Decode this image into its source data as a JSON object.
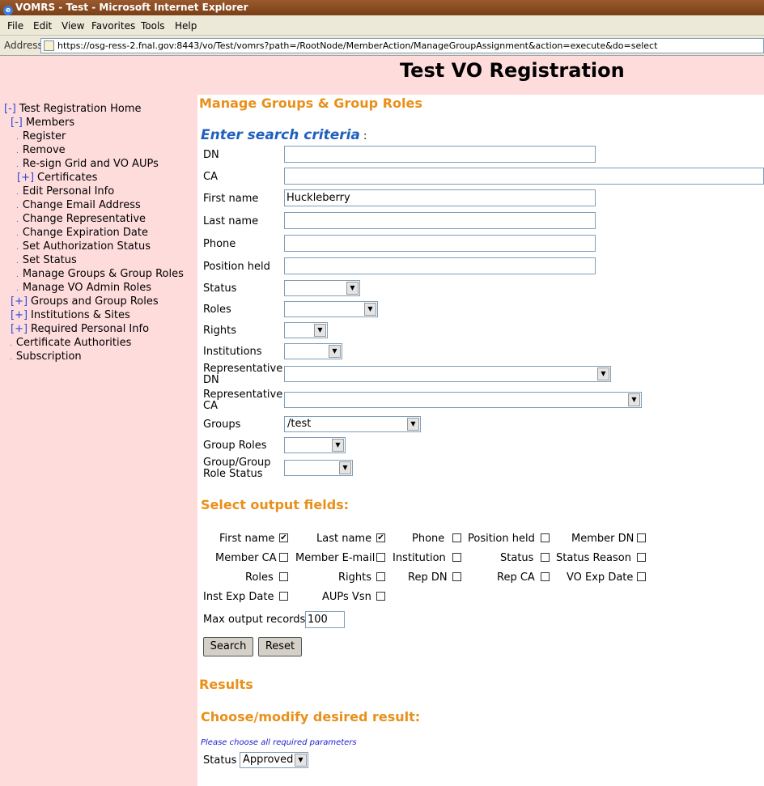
{
  "window": {
    "title": "VOMRS - Test - Microsoft Internet Explorer"
  },
  "menu": [
    "File",
    "Edit",
    "View",
    "Favorites",
    "Tools",
    "Help"
  ],
  "address": {
    "label": "Address",
    "url": "https://osg-ress-2.fnal.gov:8443/vo/Test/vomrs?path=/RootNode/MemberAction/ManageGroupAssignment&action=execute&do=select"
  },
  "header": {
    "title": "Test VO Registration"
  },
  "sidebar": {
    "items": [
      {
        "toggle": "[-]",
        "label": "Test Registration Home"
      },
      {
        "toggle": "[-]",
        "label": "Members"
      },
      {
        "bullet": ".",
        "label": "Register"
      },
      {
        "bullet": ".",
        "label": "Remove"
      },
      {
        "bullet": ".",
        "label": "Re-sign Grid and VO AUPs"
      },
      {
        "toggle": "[+]",
        "label": "Certificates"
      },
      {
        "bullet": ".",
        "label": "Edit Personal Info"
      },
      {
        "bullet": ".",
        "label": "Change Email Address"
      },
      {
        "bullet": ".",
        "label": "Change Representative"
      },
      {
        "bullet": ".",
        "label": "Change Expiration Date"
      },
      {
        "bullet": ".",
        "label": "Set Authorization Status"
      },
      {
        "bullet": ".",
        "label": "Set Status"
      },
      {
        "bullet": ".",
        "label": "Manage Groups & Group Roles"
      },
      {
        "bullet": ".",
        "label": "Manage VO Admin Roles"
      },
      {
        "toggle": "[+]",
        "label": "Groups and Group Roles"
      },
      {
        "toggle": "[+]",
        "label": "Institutions & Sites"
      },
      {
        "toggle": "[+]",
        "label": "Required Personal Info"
      },
      {
        "bullet": ".",
        "label": "Certificate Authorities"
      },
      {
        "bullet": ".",
        "label": "Subscription"
      }
    ]
  },
  "main": {
    "page_title": "Manage Groups & Group Roles",
    "search_heading": "Enter search criteria",
    "search_colon": ":",
    "fields": {
      "dn": {
        "label": "DN",
        "value": ""
      },
      "ca": {
        "label": "CA",
        "value": ""
      },
      "first_name": {
        "label": "First name",
        "value": "Huckleberry"
      },
      "last_name": {
        "label": "Last name",
        "value": ""
      },
      "phone": {
        "label": "Phone",
        "value": ""
      },
      "position": {
        "label": "Position held",
        "value": ""
      },
      "status": {
        "label": "Status",
        "value": ""
      },
      "roles": {
        "label": "Roles",
        "value": ""
      },
      "rights": {
        "label": "Rights",
        "value": ""
      },
      "institutions": {
        "label": "Institutions",
        "value": ""
      },
      "rep_dn": {
        "label1": "Representative",
        "label2": "DN",
        "value": ""
      },
      "rep_ca": {
        "label1": "Representative",
        "label2": "CA",
        "value": ""
      },
      "groups": {
        "label": "Groups",
        "value": "/test"
      },
      "group_roles": {
        "label": "Group Roles",
        "value": ""
      },
      "group_role_status": {
        "label1": "Group/Group",
        "label2": "Role Status",
        "value": ""
      }
    },
    "output_heading": "Select output fields:",
    "outputs": [
      {
        "label": "First name",
        "checked": true
      },
      {
        "label": "Last name",
        "checked": true
      },
      {
        "label": "Phone",
        "checked": false
      },
      {
        "label": "Position held",
        "checked": false
      },
      {
        "label": "Member DN",
        "checked": false
      },
      {
        "label": "Member CA",
        "checked": false
      },
      {
        "label": "Member E-mail",
        "checked": false
      },
      {
        "label": "Institution",
        "checked": false
      },
      {
        "label": "Status",
        "checked": false
      },
      {
        "label": "Status Reason",
        "checked": false
      },
      {
        "label": "Roles",
        "checked": false
      },
      {
        "label": "Rights",
        "checked": false
      },
      {
        "label": "Rep DN",
        "checked": false
      },
      {
        "label": "Rep CA",
        "checked": false
      },
      {
        "label": "VO Exp Date",
        "checked": false
      },
      {
        "label": "Inst Exp Date",
        "checked": false
      },
      {
        "label": "AUPs Vsn",
        "checked": false
      }
    ],
    "max_records": {
      "label": "Max output records",
      "value": "100"
    },
    "search_button": "Search",
    "reset_button": "Reset",
    "results_heading": "Results",
    "choose_heading": "Choose/modify desired result:",
    "hint": "Please choose all required parameters",
    "result_status": {
      "label": "Status",
      "value": "Approved"
    },
    "check_mark": "✔",
    "dropdown_arrow": "▼"
  },
  "colors": {
    "accent": "#e8901a",
    "sidebar_bg": "#ffdcdc",
    "link_blue": "#2b4bd6",
    "heading_blue": "#1f5fbf"
  }
}
